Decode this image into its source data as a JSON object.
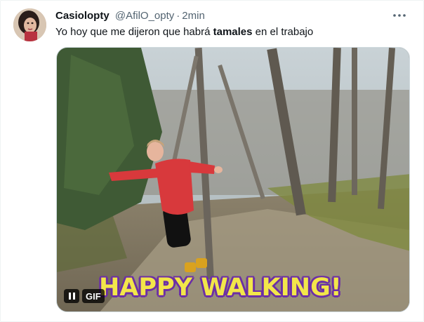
{
  "tweet": {
    "author": {
      "display_name": "Casiolopty",
      "handle": "@AfilO_opty",
      "separator": "·",
      "time": "2min"
    },
    "more_icon": "more-dots-icon",
    "text_before": "Yo hoy que me dijeron que habrá ",
    "text_bold": "tamales",
    "text_after": " en el trabajo",
    "media": {
      "caption": "HAPPY WALKING!",
      "gif_label": "GIF",
      "pause_icon": "pause-icon"
    }
  }
}
